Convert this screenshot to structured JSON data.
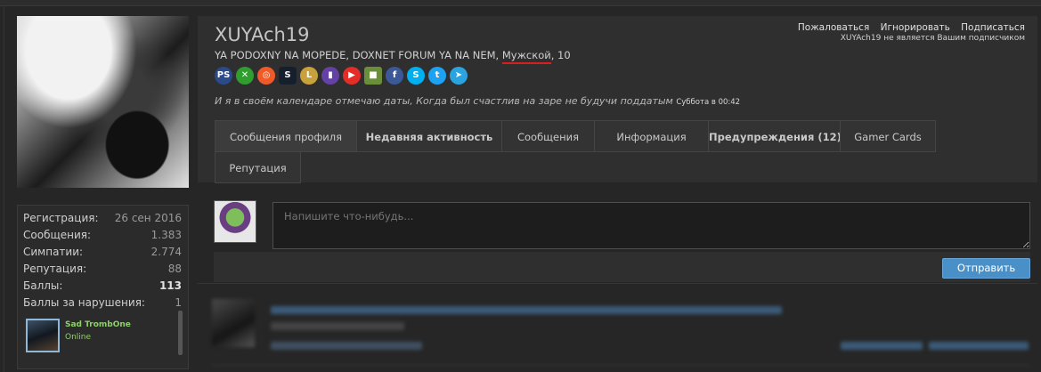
{
  "profile": {
    "username": "XUYAch19",
    "subtitle_prefix": "YA PODOXNY NA MOPEDE, DOXNET FORUM YA NA NEM, ",
    "gender": "Мужской",
    "age_suffix": ", 10",
    "status_text": "И я в своём календаре отмечаю даты, Когда был счастлив на заре не будучи поддатым",
    "status_time": "Суббота в 00:42"
  },
  "actions": {
    "report": "Пожаловаться",
    "ignore": "Игнорировать",
    "follow": "Подписаться",
    "follow_note": "XUYAch19 не является Вашим подписчиком"
  },
  "icons": [
    {
      "name": "playstation-icon",
      "color": "#2a4a8a",
      "glyph": "PS"
    },
    {
      "name": "xbox-icon",
      "color": "#2f9e2f",
      "glyph": "✕"
    },
    {
      "name": "origin-icon",
      "color": "#f05a28",
      "glyph": "◎"
    },
    {
      "name": "steam-icon",
      "color": "#16202d",
      "glyph": "S"
    },
    {
      "name": "lol-icon",
      "color": "#c8a13c",
      "glyph": "L"
    },
    {
      "name": "twitch-icon",
      "color": "#6441a5",
      "glyph": "▮"
    },
    {
      "name": "youtube-icon",
      "color": "#e52d27",
      "glyph": "▶"
    },
    {
      "name": "minecraft-icon",
      "color": "#6b8e3a",
      "glyph": "■"
    },
    {
      "name": "facebook-icon",
      "color": "#3b5998",
      "glyph": "f"
    },
    {
      "name": "skype-icon",
      "color": "#00aff0",
      "glyph": "S"
    },
    {
      "name": "twitter-icon",
      "color": "#1da1f2",
      "glyph": "t"
    },
    {
      "name": "telegram-icon",
      "color": "#2aa3df",
      "glyph": "➤"
    }
  ],
  "tabs": [
    {
      "label": "Сообщения профиля"
    },
    {
      "label": "Недавняя активность"
    },
    {
      "label": "Сообщения"
    },
    {
      "label": "Информация"
    },
    {
      "label": "Предупреждения (12)"
    },
    {
      "label": "Gamer Cards"
    },
    {
      "label": "Репутация"
    }
  ],
  "stats": [
    {
      "key": "Регистрация:",
      "value": "26 сен 2016"
    },
    {
      "key": "Сообщения:",
      "value": "1.383"
    },
    {
      "key": "Симпатии:",
      "value": "2.774"
    },
    {
      "key": "Репутация:",
      "value": "88"
    },
    {
      "key": "Баллы:",
      "value": "113"
    },
    {
      "key": "Баллы за нарушения:",
      "value": "1"
    }
  ],
  "follower": {
    "name": "Sad TrombOne",
    "status": "Online"
  },
  "composer": {
    "placeholder": "Напишите что-нибудь...",
    "submit_label": "Отправить"
  },
  "colors": {
    "accent": "#4a90c8",
    "online": "#8fce6e",
    "gender_underline": "#d42020"
  }
}
